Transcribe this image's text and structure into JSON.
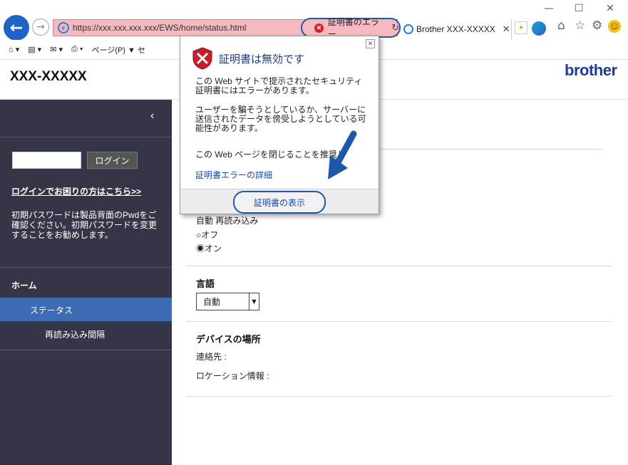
{
  "browser": {
    "url": "https://xxx.xxx.xxx.xxx/EWS/home/status.html",
    "cert_error_label": "証明書のエラー",
    "tab_title": "Brother XXX-XXXXX",
    "command_page_label": "ページ(P) ▼ セ"
  },
  "header": {
    "model": "XXX-XXXXX",
    "brand": "brother"
  },
  "sidebar": {
    "collapse_icon": "‹",
    "password_value": "",
    "login_button": "ログイン",
    "login_help": "ログインでお困りの方はこちら>>",
    "password_note": "初期パスワードは製品背面のPwdをご確認ください。初期パスワードを変更することをお勧めします。",
    "nav": {
      "home": "ホーム",
      "status": "ステータス",
      "reload_interval": "再読み込み間隔"
    }
  },
  "main": {
    "auto_reload_label": "自動 再読み込み",
    "radio_off": "○オフ",
    "radio_on": "◉オン",
    "language_heading": "言語",
    "language_value": "自動",
    "location_heading": "デバイスの場所",
    "contact_label": "連絡先 :",
    "location_label": "ロケーション情報 :"
  },
  "popup": {
    "title": "証明書は無効です",
    "text1": "この Web サイトで提示されたセキュリティ証明書にはエラーがあります。",
    "text2": "ユーザーを騙そうとしているか、サーバーに送信されたデータを傍受しようとしている可能性があります。",
    "text3": "この Web ページを閉じることを推奨し",
    "detail_link": "証明書エラーの詳細",
    "show_cert_button": "証明書の表示"
  },
  "colors": {
    "sidebar_bg": "#343546",
    "nav_active": "#3e6cb3",
    "highlight_outline": "#1f58a8",
    "address_error_bg": "#f6b9bf"
  }
}
